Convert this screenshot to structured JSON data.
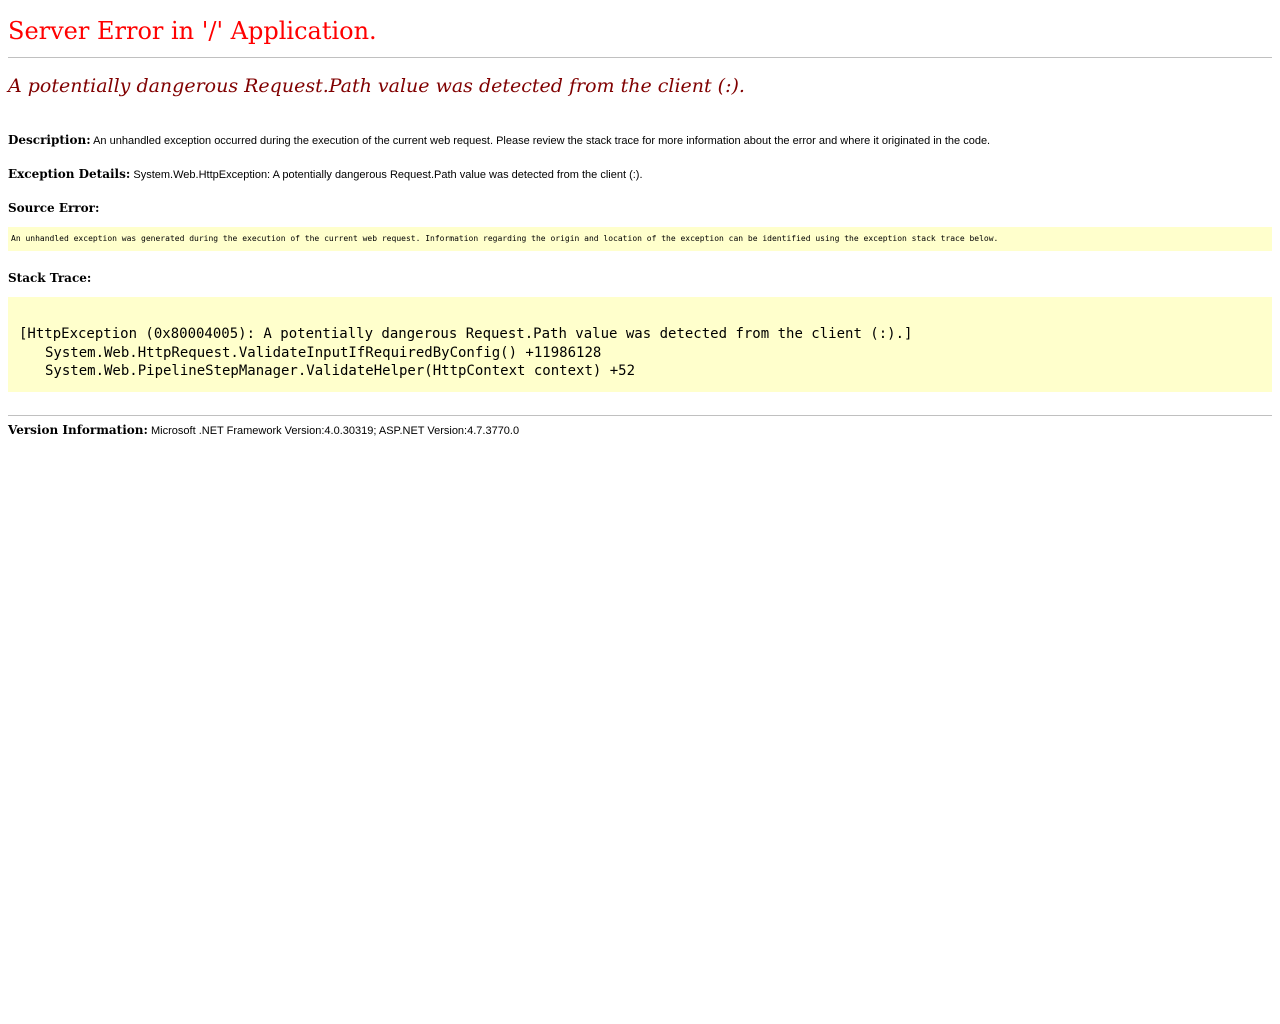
{
  "header": {
    "app_title": "Server Error in '/' Application.",
    "error_title": "A potentially dangerous Request.Path value was detected from the client (:)."
  },
  "description": {
    "label": "Description:",
    "text": "An unhandled exception occurred during the execution of the current web request. Please review the stack trace for more information about the error and where it originated in the code."
  },
  "exception_details": {
    "label": "Exception Details:",
    "text": "System.Web.HttpException: A potentially dangerous Request.Path value was detected from the client (:)."
  },
  "source_error": {
    "label": "Source Error:",
    "text": "An unhandled exception was generated during the execution of the current web request. Information regarding the origin and location of the exception can be identified using the exception stack trace below."
  },
  "stack_trace": {
    "label": "Stack Trace:",
    "lines": [
      "[HttpException (0x80004005): A potentially dangerous Request.Path value was detected from the client (:).]",
      "System.Web.HttpRequest.ValidateInputIfRequiredByConfig() +11986128",
      "System.Web.PipelineStepManager.ValidateHelper(HttpContext context) +52"
    ]
  },
  "version_info": {
    "label": "Version Information:",
    "text": "Microsoft .NET Framework Version:4.0.30319; ASP.NET Version:4.7.3770.0"
  },
  "colors": {
    "app_title": "#ff0000",
    "error_title": "#800000",
    "code_background": "#ffffcc",
    "rule": "#c0c0c0"
  }
}
